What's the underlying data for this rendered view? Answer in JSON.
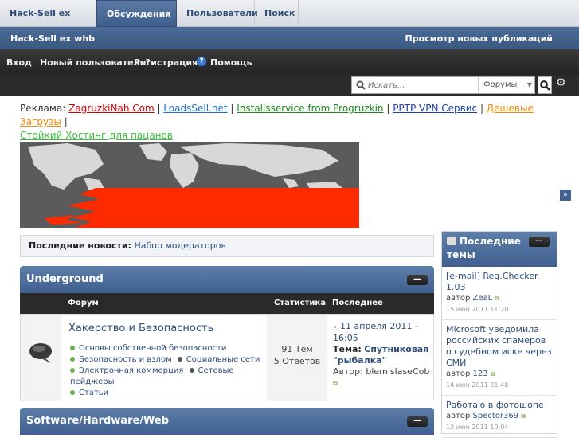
{
  "tabs": [
    "Hack-Sell ex whb",
    "Обсуждения",
    "Пользователи",
    "Поиск"
  ],
  "header": {
    "site_title": "Hack-Sell ex whb",
    "new_posts": "Просмотр новых публикаций"
  },
  "userbar": {
    "login": "Вход",
    "new_user": "Новый пользователь?",
    "register": "Регистрация",
    "help": "Помощь"
  },
  "search": {
    "placeholder": "Искать...",
    "scope": "Форумы"
  },
  "ads": {
    "label": "Реклама:",
    "links": [
      "ZagruzkiNah.Com",
      "LoadsSell.net",
      "Installsservice from Progruzkin",
      "PPTP VPN Сервис",
      "Дешевые Загрузы",
      "Стойкий Хостинг для пацанов"
    ],
    "colors": [
      "#d40000",
      "#1c6fd1",
      "#1a8a1a",
      "#1a3fae",
      "#f08a00",
      "#3ac23a"
    ]
  },
  "news": {
    "label": "Последние новости:",
    "link": "Набор модераторов"
  },
  "categories": [
    {
      "title": "Underground",
      "min": "—"
    },
    {
      "title": "Software/Hardware/Web",
      "min": "—"
    }
  ],
  "columns": {
    "forum": "Форум",
    "stats": "Статистика",
    "last": "Последнее сообщение"
  },
  "forum": {
    "title": "Хакерство и Безопасность",
    "subforums": [
      {
        "name": "Основы собственной безопасности",
        "color": "#6ab04c"
      },
      {
        "name": "Безопасность и взлом",
        "color": "#6ab04c"
      },
      {
        "name": "Социальные сети",
        "color": "#555555"
      },
      {
        "name": "Электронная коммерция",
        "color": "#6ab04c"
      },
      {
        "name": "Сетевые пейджеры",
        "color": "#555555"
      },
      {
        "name": "Статьи",
        "color": "#6ab04c"
      }
    ],
    "topics": "91 Тем",
    "replies": "5 Ответов",
    "last_date": "11 апреля 2011 - 16:05",
    "last_topic_label": "Тема:",
    "last_topic": "Спутниковая \"рыбалка\"",
    "last_author_label": "Автор:",
    "last_author": "blemislaseCob"
  },
  "sidebar": {
    "title": "Последние темы",
    "items": [
      {
        "title": "[e-mail] Reg.Checker 1.03",
        "author_label": "автор",
        "author": "ZeaL",
        "date": "15 июн 2011 11:20"
      },
      {
        "title": "Microsoft уведомила российских спамеров о судебном иске через СМИ",
        "author_label": "автор",
        "author": "123",
        "date": "14 июн 2011 21:48"
      },
      {
        "title": "Работаю в фотошопе",
        "author_label": "автор",
        "author": "Spector369",
        "date": "12 июн 2011 10:04"
      }
    ]
  }
}
